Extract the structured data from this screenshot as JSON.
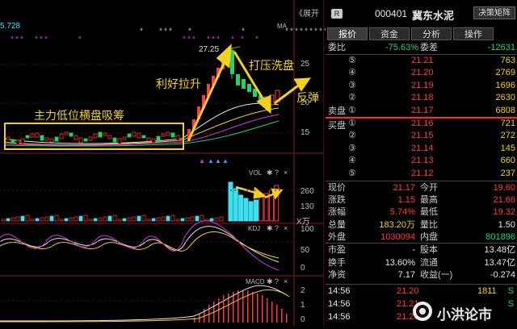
{
  "top_value": "5.728",
  "expand_label": "《展开",
  "ma_label": "MA",
  "stars_line1": "*   ***   *          *        *******************",
  "stars_line2": "***  ***  * *  *",
  "price_high_label": "27.25",
  "annotations": {
    "accumulation": "主力低位横盘吸筹",
    "good_news": "利好拉升",
    "washout": "打压洗盘",
    "rebound": "反弹"
  },
  "price_axis": [
    "25",
    "20",
    "15"
  ],
  "vol_panel": {
    "label": "VOL",
    "axis": [
      "260",
      "130"
    ],
    "unit": "X万"
  },
  "kdj_panel": {
    "label": "KDJ",
    "axis": [
      "100",
      "50",
      "0"
    ]
  },
  "macd_panel": {
    "label": "MACD",
    "axis": [
      "2",
      "1",
      "0"
    ]
  },
  "header": {
    "badge": "R",
    "code": "000401",
    "name": "冀东水泥",
    "matrix_button": "决策矩阵"
  },
  "tabs": [
    "报价",
    "资金",
    "分析",
    "操作"
  ],
  "ratio": {
    "wb_label": "委比",
    "wb_value": "-75.63%",
    "wc_label": "委差",
    "wc_value": "-12631"
  },
  "sell_side_label": "卖盘",
  "buy_side_label": "买盘",
  "sells": [
    {
      "level": "⑤",
      "price": "21.21",
      "volume": "763"
    },
    {
      "level": "④",
      "price": "21.20",
      "volume": "2769"
    },
    {
      "level": "③",
      "price": "21.19",
      "volume": "1696"
    },
    {
      "level": "②",
      "price": "21.18",
      "volume": "2630"
    },
    {
      "level": "①",
      "price": "21.17",
      "volume": "6808"
    }
  ],
  "buys": [
    {
      "level": "①",
      "price": "21.16",
      "volume": "721"
    },
    {
      "level": "②",
      "price": "21.15",
      "volume": "272"
    },
    {
      "level": "③",
      "price": "21.14",
      "volume": "145"
    },
    {
      "level": "④",
      "price": "21.13",
      "volume": "660"
    },
    {
      "level": "⑤",
      "price": "21.12",
      "volume": "237"
    }
  ],
  "quote": [
    {
      "l1": "现价",
      "v1": "21.17",
      "l2": "今开",
      "v2": "19.60"
    },
    {
      "l1": "涨跌",
      "v1": "1.15",
      "l2": "最高",
      "v2": "21.66"
    },
    {
      "l1": "涨幅",
      "v1": "5.74%",
      "l2": "最低",
      "v2": "19.32"
    },
    {
      "l1": "总量",
      "v1": "183.20万",
      "l2": "量比",
      "v2": "1.50"
    },
    {
      "l1": "外盘",
      "v1": "1030094",
      "l2": "内盘",
      "v2": "801896"
    }
  ],
  "fundamentals": [
    {
      "l1": "市盈",
      "v1": "-",
      "l2": "股本",
      "v2": "13.48亿"
    },
    {
      "l1": "换手",
      "v1": "13.60%",
      "l2": "流通",
      "v2": "13.47亿"
    },
    {
      "l1": "净资",
      "v1": "7.17",
      "l2": "收益(一)",
      "v2": "-0.274"
    }
  ],
  "ticks": [
    {
      "time": "14:56",
      "price": "21.20",
      "vol": "1811",
      "flag": "S"
    },
    {
      "time": "14:56",
      "price": "21.21",
      "vol": "",
      "flag": "S"
    },
    {
      "time": "14:56",
      "price": "21.20",
      "vol": "",
      "flag": ""
    }
  ],
  "watermark": "小洪论市",
  "colors": {
    "up": "#ff3b3b",
    "down": "#22d36a",
    "accent": "#f2d21d",
    "cyan": "#3ee0f0"
  }
}
